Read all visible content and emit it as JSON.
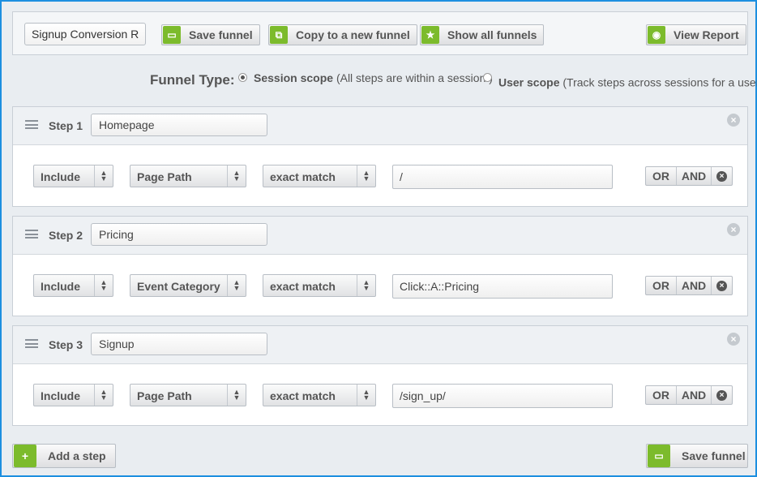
{
  "toolbar": {
    "funnel_name": "Signup Conversion Report",
    "save_label": "Save funnel",
    "copy_label": "Copy to a new funnel",
    "show_all_label": "Show all funnels",
    "view_report_label": "View Report"
  },
  "funnel_type": {
    "title": "Funnel Type:",
    "options": [
      {
        "name": "Session scope",
        "description": "(All steps are within a session.)",
        "selected": true
      },
      {
        "name": "User scope",
        "description": "(Track steps across sessions for a user.",
        "sup": "*",
        "close": ")",
        "selected": false
      }
    ]
  },
  "steps": [
    {
      "label": "Step 1",
      "name": "Homepage",
      "rule": {
        "include": "Include",
        "dimension": "Page Path",
        "match": "exact match",
        "value": "/"
      }
    },
    {
      "label": "Step 2",
      "name": "Pricing",
      "rule": {
        "include": "Include",
        "dimension": "Event Category",
        "match": "exact match",
        "value": "Click::A::Pricing"
      }
    },
    {
      "label": "Step 3",
      "name": "Signup",
      "rule": {
        "include": "Include",
        "dimension": "Page Path",
        "match": "exact match",
        "value": "/sign_up/"
      }
    }
  ],
  "logic": {
    "or": "OR",
    "and": "AND"
  },
  "footer": {
    "add_step_label": "Add a step",
    "save_label": "Save funnel"
  },
  "colors": {
    "accent_green": "#7cbb2c",
    "frame_blue": "#1c8fe0"
  }
}
